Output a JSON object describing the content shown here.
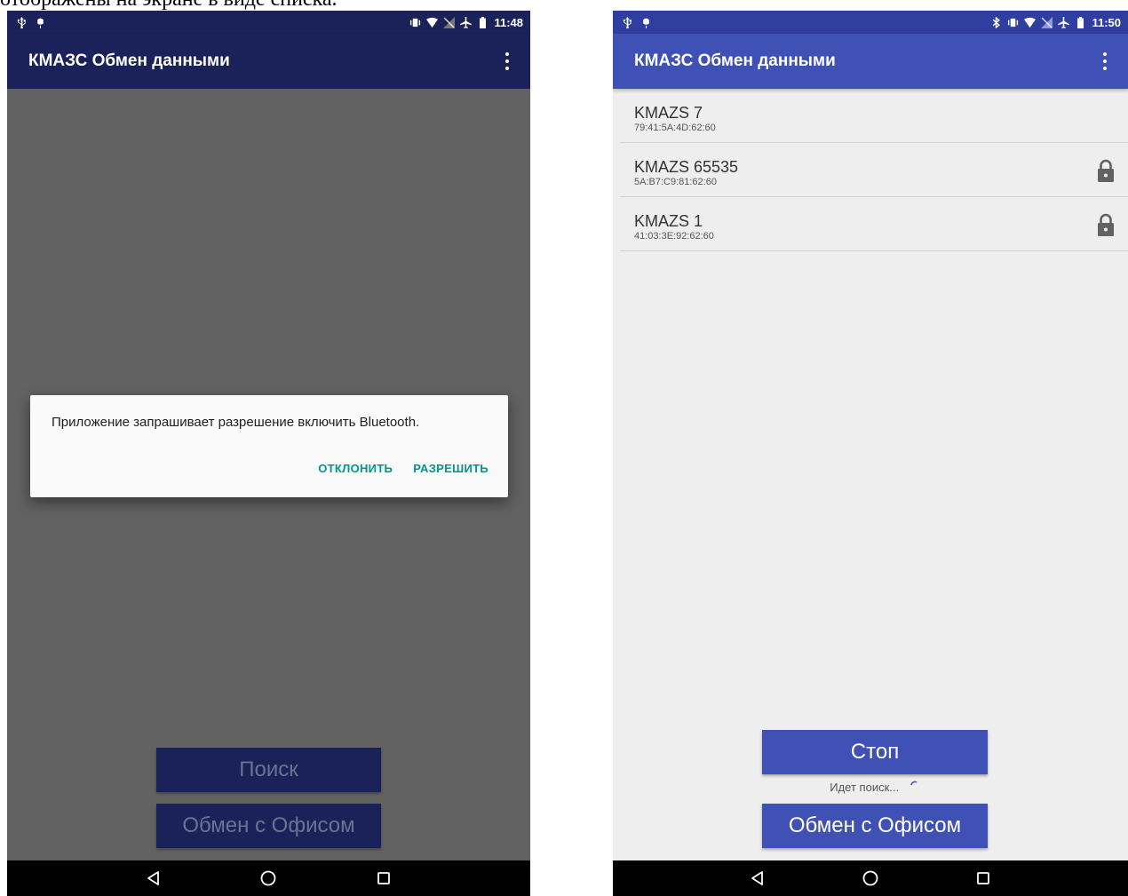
{
  "document": {
    "caption_fragment": "отображены на экране в виде списка."
  },
  "left_screen": {
    "status_bar": {
      "time": "11:48"
    },
    "app_bar": {
      "title": "КМАЗС Обмен данными"
    },
    "dialog": {
      "message": "Приложение запрашивает разрешение включить Bluetooth.",
      "deny_label": "ОТКЛОНИТЬ",
      "allow_label": "РАЗРЕШИТЬ"
    },
    "buttons": {
      "search_label": "Поиск",
      "exchange_label": "Обмен с Офисом"
    }
  },
  "right_screen": {
    "status_bar": {
      "time": "11:50"
    },
    "app_bar": {
      "title": "КМАЗС Обмен данными"
    },
    "devices": [
      {
        "name": "KMAZS 7",
        "mac": "79:41:5A:4D:62:60",
        "locked": false
      },
      {
        "name": "KMAZS 65535",
        "mac": "5A:B7:C9:81:62:60",
        "locked": true
      },
      {
        "name": "KMAZS 1",
        "mac": "41:03:3E:92:62:60",
        "locked": true
      }
    ],
    "buttons": {
      "stop_label": "Стоп",
      "exchange_label": "Обмен с Офисом"
    },
    "status_text": "Идет поиск..."
  },
  "icons": {
    "status_left": [
      "usb-icon",
      "android-debug-icon"
    ],
    "status_right_left_screen": [
      "vibrate-icon",
      "wifi-icon",
      "no-signal-icon",
      "airplane-icon",
      "battery-icon"
    ],
    "status_right_right_screen": [
      "bluetooth-icon",
      "vibrate-icon",
      "wifi-icon",
      "no-signal-icon",
      "airplane-icon",
      "battery-icon"
    ],
    "navigation": [
      "back-icon",
      "home-icon",
      "recents-icon"
    ]
  },
  "colors": {
    "primary": "#3f51b5",
    "primary_dark": "#303f9f",
    "dialog_accent": "#009688",
    "dimmed_primary": "#1a2259"
  }
}
